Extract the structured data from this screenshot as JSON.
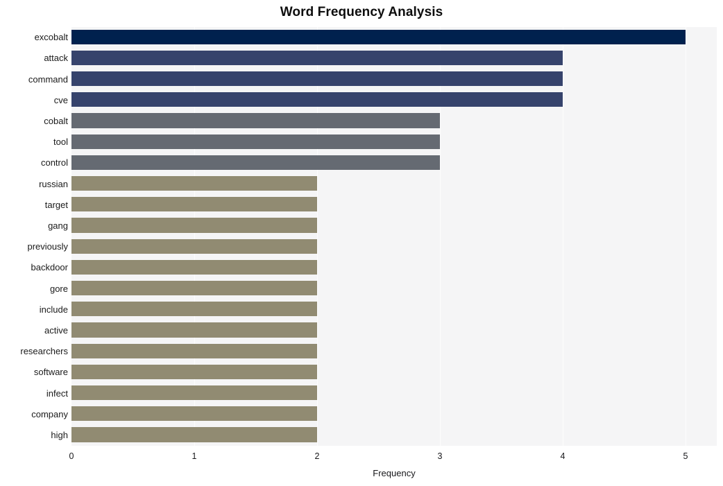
{
  "chart_data": {
    "type": "bar",
    "orientation": "horizontal",
    "title": "Word Frequency Analysis",
    "xlabel": "Frequency",
    "ylabel": "",
    "categories": [
      "excobalt",
      "attack",
      "command",
      "cve",
      "cobalt",
      "tool",
      "control",
      "russian",
      "target",
      "gang",
      "previously",
      "backdoor",
      "gore",
      "include",
      "active",
      "researchers",
      "software",
      "infect",
      "company",
      "high"
    ],
    "values": [
      5,
      4,
      4,
      4,
      3,
      3,
      3,
      2,
      2,
      2,
      2,
      2,
      2,
      2,
      2,
      2,
      2,
      2,
      2,
      2
    ],
    "bar_colors": [
      "#00214e",
      "#36436c",
      "#36436c",
      "#36436c",
      "#656a72",
      "#656a72",
      "#656a72",
      "#918b72",
      "#918b72",
      "#918b72",
      "#918b72",
      "#918b72",
      "#918b72",
      "#918b72",
      "#918b72",
      "#918b72",
      "#918b72",
      "#918b72",
      "#918b72",
      "#918b72"
    ],
    "xlim": [
      0,
      5.25
    ],
    "xticks": [
      0,
      1,
      2,
      3,
      4,
      5
    ],
    "xtick_labels": [
      "0",
      "1",
      "2",
      "3",
      "4",
      "5"
    ],
    "grid": true,
    "grid_axis": "x",
    "grid_color": "#fdfdfd",
    "plot_background": "#f5f5f6",
    "figure_background": "#ffffff",
    "legend": null
  }
}
